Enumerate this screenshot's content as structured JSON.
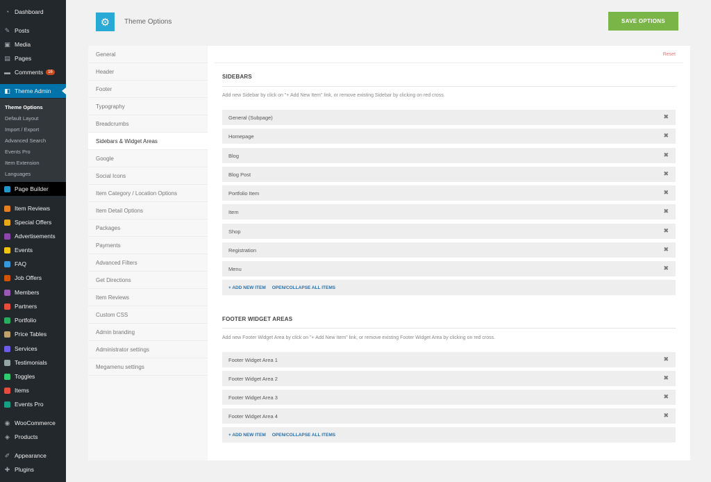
{
  "admin_menu": {
    "items": [
      {
        "label": "Dashboard",
        "icon": "dashboard-icon",
        "glyph": "◔",
        "color": ""
      },
      {
        "label": "Posts",
        "icon": "pin-icon",
        "glyph": "✎",
        "color": ""
      },
      {
        "label": "Media",
        "icon": "media-icon",
        "glyph": "▣",
        "color": ""
      },
      {
        "label": "Pages",
        "icon": "pages-icon",
        "glyph": "▤",
        "color": ""
      },
      {
        "label": "Comments",
        "icon": "comments-icon",
        "glyph": "▬",
        "color": "",
        "badge": "16"
      },
      {
        "label": "Theme Admin",
        "icon": "theme-admin-icon",
        "glyph": "◧",
        "color": "",
        "current": true
      },
      {
        "label": "Page Builder",
        "icon": "page-builder-icon",
        "glyph": "▦",
        "color": "#2196c9"
      },
      {
        "label": "Item Reviews",
        "icon": "item-reviews-icon",
        "color": "#e67e22"
      },
      {
        "label": "Special Offers",
        "icon": "special-offers-icon",
        "color": "#e6a817"
      },
      {
        "label": "Advertisements",
        "icon": "advertisements-icon",
        "color": "#8e44ad"
      },
      {
        "label": "Events",
        "icon": "events-icon",
        "color": "#f1c40f"
      },
      {
        "label": "FAQ",
        "icon": "faq-icon",
        "color": "#3498db"
      },
      {
        "label": "Job Offers",
        "icon": "job-offers-icon",
        "color": "#d35400"
      },
      {
        "label": "Members",
        "icon": "members-icon",
        "color": "#9b59b6"
      },
      {
        "label": "Partners",
        "icon": "partners-icon",
        "color": "#e74c3c"
      },
      {
        "label": "Portfolio",
        "icon": "portfolio-icon",
        "color": "#27ae60"
      },
      {
        "label": "Price Tables",
        "icon": "price-tables-icon",
        "color": "#c0a16b"
      },
      {
        "label": "Services",
        "icon": "services-icon",
        "color": "#6c5ce7"
      },
      {
        "label": "Testimonials",
        "icon": "testimonials-icon",
        "color": "#95a5a6"
      },
      {
        "label": "Toggles",
        "icon": "toggles-icon",
        "color": "#2ecc71"
      },
      {
        "label": "Items",
        "icon": "items-icon",
        "color": "#e74c3c"
      },
      {
        "label": "Events Pro",
        "icon": "events-pro-icon",
        "color": "#16a085"
      },
      {
        "label": "WooCommerce",
        "icon": "woocommerce-icon",
        "glyph": "◉",
        "color": ""
      },
      {
        "label": "Products",
        "icon": "products-icon",
        "glyph": "◈",
        "color": ""
      },
      {
        "label": "Appearance",
        "icon": "appearance-icon",
        "glyph": "✐",
        "color": ""
      },
      {
        "label": "Plugins",
        "icon": "plugins-icon",
        "glyph": "✚",
        "color": ""
      }
    ],
    "submenu": [
      "Theme Options",
      "Default Layout",
      "Import / Export",
      "Advanced Search",
      "Events Pro",
      "Item Extension",
      "Languages"
    ]
  },
  "header": {
    "title": "Theme Options",
    "save_label": "SAVE OPTIONS",
    "logo_icon": "gears-icon"
  },
  "tabs": [
    "General",
    "Header",
    "Footer",
    "Typography",
    "Breadcrumbs",
    "Sidebars & Widget Areas",
    "Google",
    "Social Icons",
    "Item Category / Location Options",
    "Item Detail Options",
    "Packages",
    "Payments",
    "Advanced Filters",
    "Get Directions",
    "Item Reviews",
    "Custom CSS",
    "Admin branding",
    "Administrator settings",
    "Megamenu settings"
  ],
  "active_tab": "Sidebars & Widget Areas",
  "reset_label": "Reset",
  "sidebars": {
    "title": "SIDEBARS",
    "description": "Add new Sidebar by click on \"+ Add New Item\" link, or remove existing Sidebar by clicking on red cross.",
    "items": [
      "General (Subpage)",
      "Homepage",
      "Blog",
      "Blog Post",
      "Portfolio Item",
      "Item",
      "Shop",
      "Registration",
      "Menu"
    ],
    "add_label": "+ ADD NEW ITEM",
    "toggle_label": "OPEN/COLLAPSE ALL ITEMS"
  },
  "footer_widgets": {
    "title": "FOOTER WIDGET AREAS",
    "description": "Add new Footer Widget Area by click on \"+ Add New Item\" link, or remove existing Footer Widget Area by clicking on red cross.",
    "items": [
      "Footer Widget Area 1",
      "Footer Widget Area 2",
      "Footer Widget Area 3",
      "Footer Widget Area 4"
    ],
    "add_label": "+ ADD NEW ITEM",
    "toggle_label": "OPEN/COLLAPSE ALL ITEMS"
  }
}
